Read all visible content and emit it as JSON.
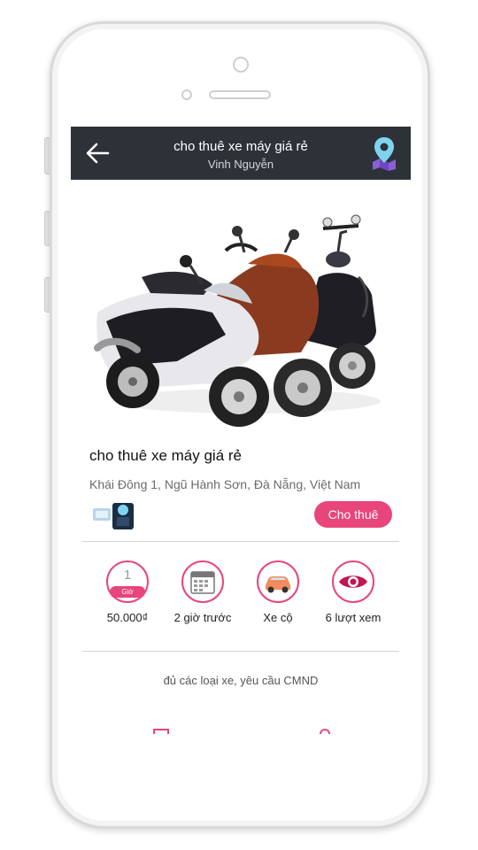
{
  "header": {
    "title": "cho thuê xe máy giá rẻ",
    "subtitle": "Vinh Nguyễn"
  },
  "listing": {
    "title": "cho thuê xe máy giá rẻ",
    "address": "Khái Đông 1, Ngũ Hành Sơn, Đà Nẵng, Việt Nam",
    "action_label": "Cho thuê"
  },
  "stats": {
    "hour_number": "1",
    "hour_tag": "Giờ",
    "price": "50.000₫",
    "posted": "2 giờ trước",
    "category": "Xe cộ",
    "views": "6 lượt xem"
  },
  "description": "đủ các loại xe, yêu cầu CMND",
  "colors": {
    "accent": "#e8457b",
    "header_bg": "#2d3238",
    "map_pin": "#7fd3f0"
  },
  "icons": [
    "back-arrow-icon",
    "map-pin-icon",
    "calendar-icon",
    "car-icon",
    "eye-icon"
  ]
}
